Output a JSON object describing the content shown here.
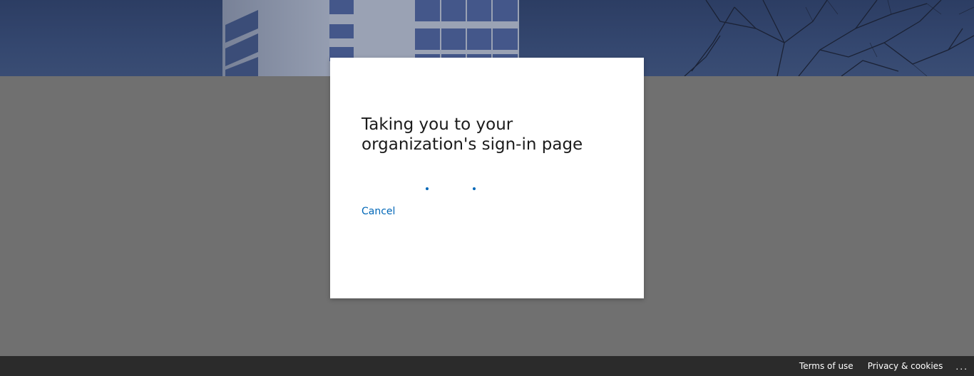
{
  "dialog": {
    "title": "Taking you to your organization's sign-in page",
    "cancel_label": "Cancel"
  },
  "footer": {
    "terms_label": "Terms of use",
    "privacy_label": "Privacy & cookies",
    "more_label": "..."
  },
  "icons": {
    "more": "ellipsis-icon",
    "progress": "progress-dots-icon"
  },
  "colors": {
    "accent": "#0067b8",
    "page_background": "#707070",
    "footer_background": "#2b2b2b",
    "card_background": "#ffffff",
    "banner_background": "#34476f"
  }
}
